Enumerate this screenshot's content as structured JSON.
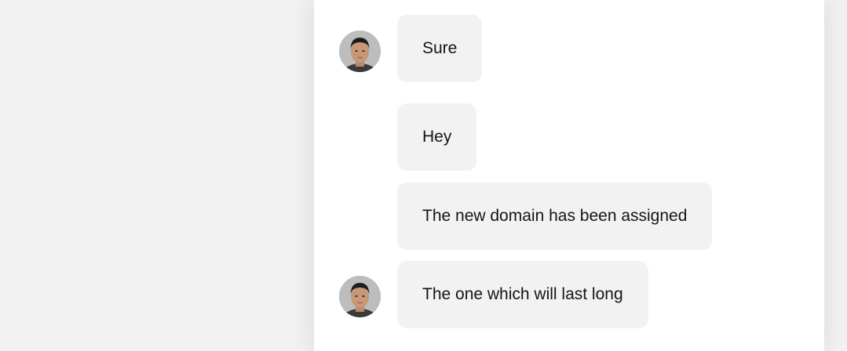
{
  "chat": {
    "messages": [
      {
        "text": "Sure",
        "has_avatar": true
      },
      {
        "text": "Hey",
        "has_avatar": false
      },
      {
        "text": "The new domain has been assigned",
        "has_avatar": false
      },
      {
        "text": "The one which will last long",
        "has_avatar": true
      }
    ],
    "colors": {
      "page_background": "#f1f1f1",
      "panel_background": "#ffffff",
      "bubble_background": "#f2f2f2",
      "text": "#151515"
    },
    "icons": {
      "avatar": "user-avatar-photo"
    }
  }
}
